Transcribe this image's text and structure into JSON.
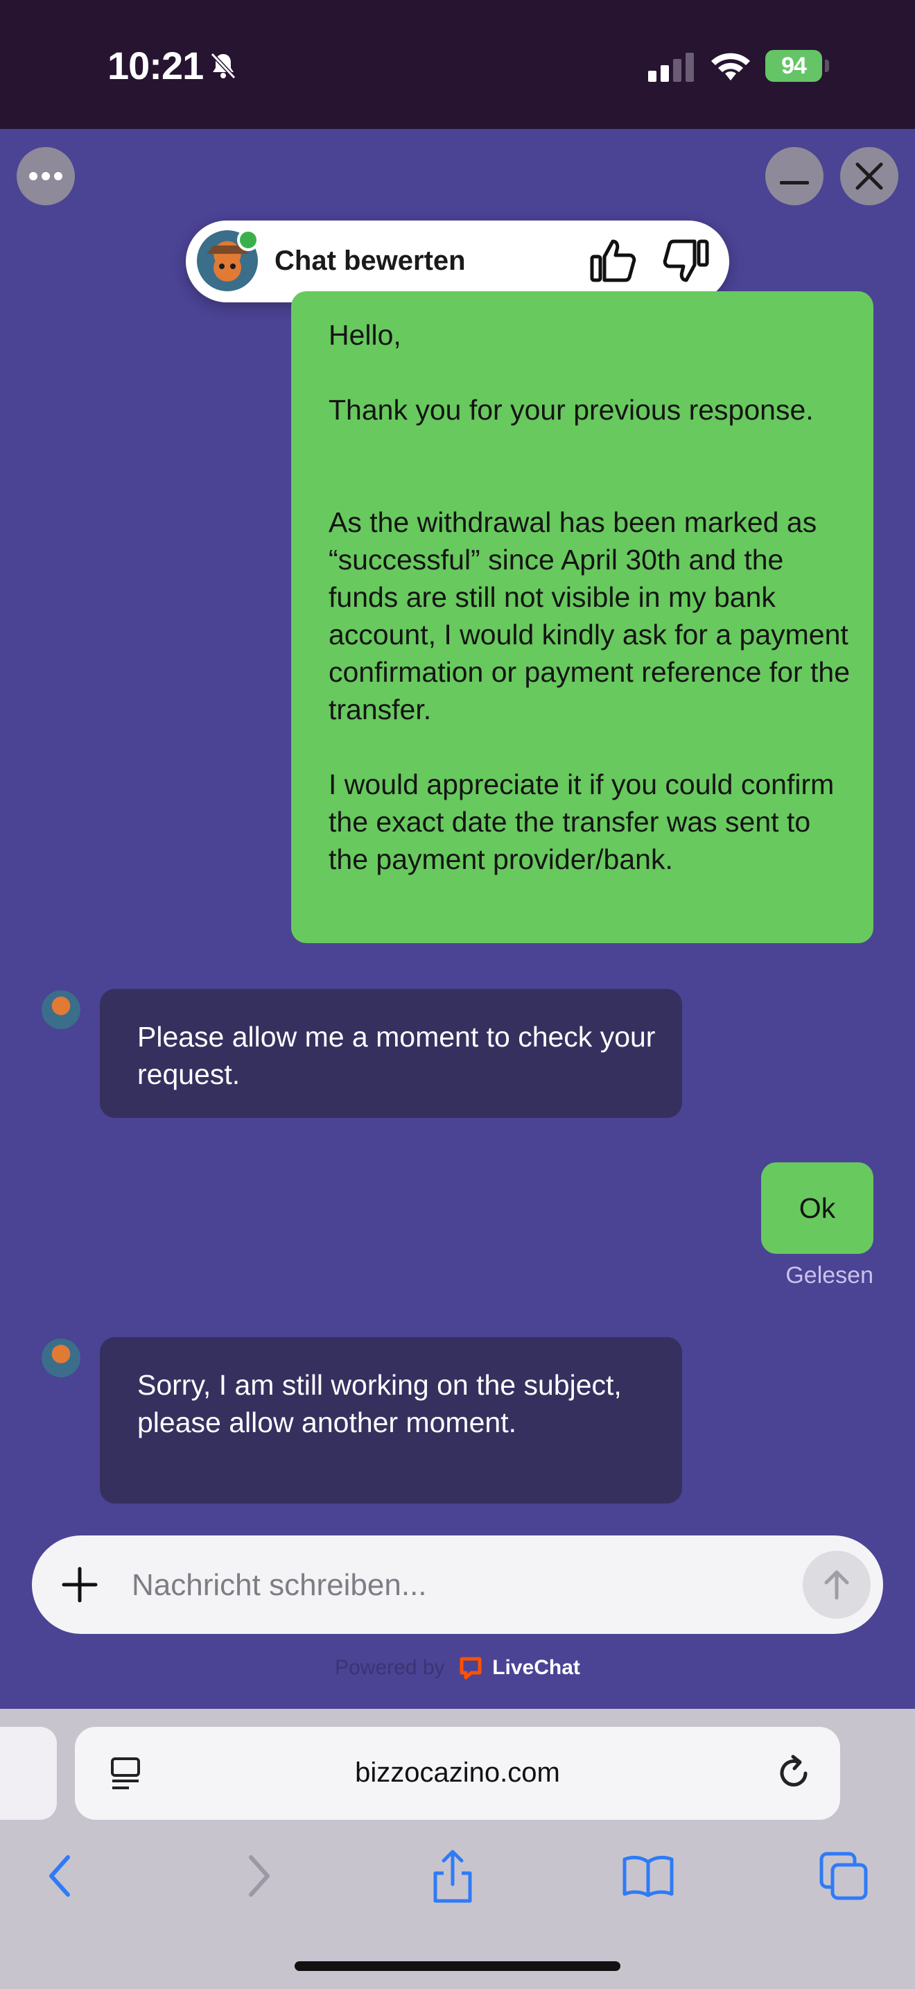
{
  "status_bar": {
    "time": "10:21",
    "battery": "94",
    "icons": [
      "bell-slash-icon",
      "signal-icon",
      "wifi-icon",
      "battery-charging-icon"
    ]
  },
  "chat_header": {
    "icons": [
      "more-icon",
      "minimize-icon",
      "close-icon"
    ]
  },
  "rating": {
    "label": "Chat bewerten",
    "icons": [
      "thumbs-up-icon",
      "thumbs-down-icon"
    ]
  },
  "messages": [
    {
      "sender": "user",
      "paragraphs": [
        "Hello,",
        "Thank you for your previous response.",
        "As the withdrawal has been marked as “successful” since April 30th and the funds are still not visible in my bank account, I would kindly ask for a payment confirmation or payment reference for the transfer.",
        "I would appreciate it if you could confirm the exact date the transfer was sent to the payment provider/bank."
      ]
    },
    {
      "sender": "agent",
      "text": "Please allow me a moment to check your request."
    },
    {
      "sender": "user",
      "text": "Ok",
      "status": "Gelesen"
    },
    {
      "sender": "agent",
      "text": "Sorry, I am still working on the subject, please allow another moment."
    }
  ],
  "composer": {
    "placeholder": "Nachricht schreiben...",
    "icons": [
      "plus-icon",
      "send-arrow-icon"
    ]
  },
  "footer": {
    "powered_by": "Powered by",
    "brand": "LiveChat",
    "brand_color": "#ff5100"
  },
  "browser": {
    "url": "bizzocazino.com",
    "icons": [
      "reader-icon",
      "reload-icon",
      "back-icon",
      "forward-icon",
      "share-icon",
      "bookmarks-icon",
      "tabs-icon"
    ]
  },
  "colors": {
    "chat_background": "#4b4394",
    "user_bubble": "#68c95e",
    "agent_bubble": "#36305f",
    "status_bar": "#261431",
    "accent_blue": "#2f7bf6"
  }
}
